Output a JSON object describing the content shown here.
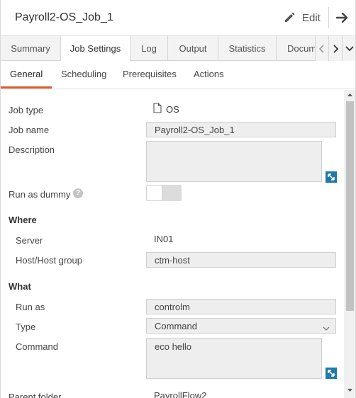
{
  "header": {
    "title": "Payroll2-OS_Job_1",
    "edit_label": "Edit",
    "edit_icon": "pencil-icon",
    "next_icon": "arrow-right-icon"
  },
  "main_tabs": [
    {
      "label": "Summary",
      "active": false
    },
    {
      "label": "Job Settings",
      "active": true
    },
    {
      "label": "Log",
      "active": false
    },
    {
      "label": "Output",
      "active": false
    },
    {
      "label": "Statistics",
      "active": false
    },
    {
      "label": "Documentation",
      "active": false
    }
  ],
  "sub_tabs": [
    {
      "label": "General",
      "active": true
    },
    {
      "label": "Scheduling",
      "active": false
    },
    {
      "label": "Prerequisites",
      "active": false
    },
    {
      "label": "Actions",
      "active": false
    }
  ],
  "form": {
    "job_type": {
      "label": "Job type",
      "value": "OS",
      "icon": "document-icon"
    },
    "job_name": {
      "label": "Job name",
      "value": "Payroll2-OS_Job_1"
    },
    "description": {
      "label": "Description",
      "value": ""
    },
    "run_as_dummy": {
      "label": "Run as dummy",
      "value": false
    },
    "where": {
      "heading": "Where",
      "server": {
        "label": "Server",
        "value": "IN01"
      },
      "host": {
        "label": "Host/Host group",
        "value": "ctm-host"
      }
    },
    "what": {
      "heading": "What",
      "run_as": {
        "label": "Run as",
        "value": "controlm"
      },
      "type": {
        "label": "Type",
        "value": "Command"
      },
      "command": {
        "label": "Command",
        "value": "eco hello"
      }
    },
    "parent_folder": {
      "label": "Parent folder",
      "value": "PayrollFlow2"
    }
  },
  "colors": {
    "accent": "#e05a2b",
    "expand_button": "#1f7aa8"
  }
}
